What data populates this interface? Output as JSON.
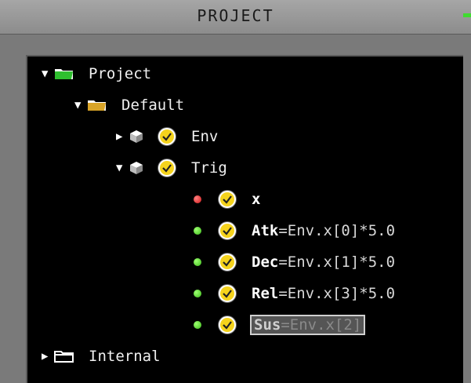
{
  "panel": {
    "title": "PROJECT"
  },
  "tree": {
    "project": {
      "label": "Project"
    },
    "default": {
      "label": "Default"
    },
    "env": {
      "label": "Env"
    },
    "trig": {
      "label": "Trig"
    },
    "vars": [
      {
        "name": "x",
        "expr": "",
        "status": "red"
      },
      {
        "name": "Atk",
        "expr": "=Env.x[0]*5.0",
        "status": "green"
      },
      {
        "name": "Dec",
        "expr": "=Env.x[1]*5.0",
        "status": "green"
      },
      {
        "name": "Rel",
        "expr": "=Env.x[3]*5.0",
        "status": "green"
      },
      {
        "name": "Sus",
        "expr": "=Env.x[2]",
        "status": "green",
        "selected": true
      }
    ],
    "internal": {
      "label": "Internal"
    }
  },
  "colors": {
    "check_yellow": "#f5d31c",
    "status_green": "#3cbc1a",
    "status_red": "#d21818",
    "accent_green": "#3fdc2f"
  }
}
